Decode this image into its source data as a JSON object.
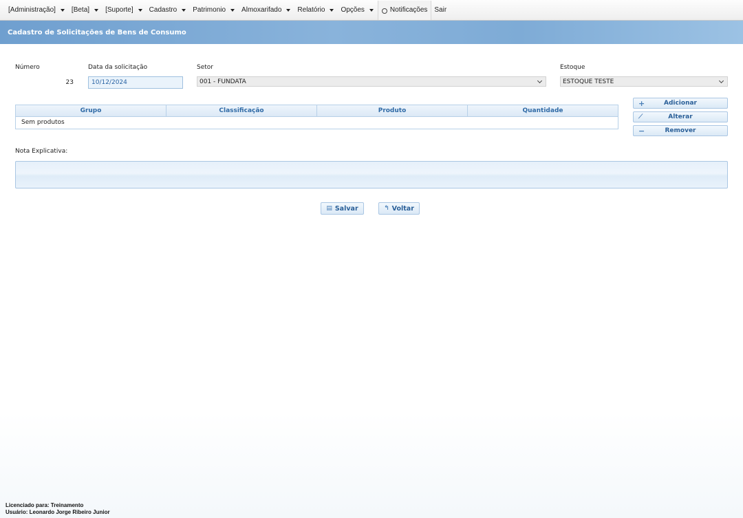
{
  "menu": {
    "administracao": "[Administração]",
    "beta": "[Beta]",
    "suporte": "[Suporte]",
    "cadastro": "Cadastro",
    "patrimonio": "Patrimonio",
    "almoxarifado": "Almoxarifado",
    "relatorio": "Relatório",
    "opcoes": "Opções",
    "notificacoes": "Notificações",
    "sair": "Sair"
  },
  "page": {
    "title": "Cadastro de Solicitações de Bens de Consumo"
  },
  "form": {
    "numero_label": "Número",
    "numero_value": "23",
    "data_label": "Data da solicitação",
    "data_value": "10/12/2024",
    "setor_label": "Setor",
    "setor_value": "001 - FUNDATA",
    "estoque_label": "Estoque",
    "estoque_value": "ESTOQUE TESTE",
    "nota_label": "Nota Explicativa:",
    "nota_value": ""
  },
  "table": {
    "columns": [
      "Grupo",
      "Classificação",
      "Produto",
      "Quantidade"
    ],
    "empty_text": "Sem produtos"
  },
  "side_buttons": {
    "add": "Adicionar",
    "edit": "Alterar",
    "remove": "Remover"
  },
  "actions": {
    "save": "Salvar",
    "back": "Voltar"
  },
  "footer": {
    "license": "Licenciado para: Treinamento",
    "user": "Usuário: Leonardo Jorge Ribeiro Junior"
  },
  "colors": {
    "title_band": "#7eabd6",
    "accent_text": "#2f6aa6",
    "input_bg": "#eaf3fb"
  }
}
